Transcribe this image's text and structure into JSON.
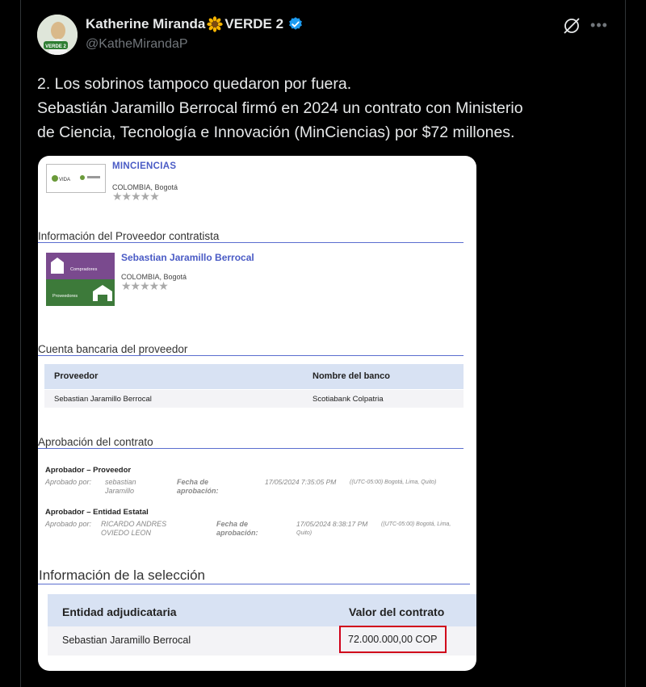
{
  "post": {
    "display_name": "Katherine Miranda",
    "name_suffix": "VERDE 2",
    "handle": "@KatheMirandaP",
    "avatar_text": "VERDE 2",
    "lines": [
      "2. Los sobrinos tampoco quedaron por fuera.",
      "Sebastián Jaramillo Berrocal firmó en 2024 un contrato con Ministerio",
      "de Ciencia, Tecnología e Innovación (MinCiencias) por $72 millones."
    ]
  },
  "doc": {
    "entity": {
      "name": "MINCIENCIAS",
      "location": "COLOMBIA, Bogotá",
      "logo_text": "VIDA",
      "stars": "★★★★★"
    },
    "provider_section": "Información del Proveedor contratista",
    "provider": {
      "name": "Sebastian Jaramillo Berrocal",
      "location": "COLOMBIA, Bogotá",
      "badge_top": "Compradores",
      "badge_bottom": "Proveedores",
      "stars": "★★★★★"
    },
    "bank_section": "Cuenta bancaria del proveedor",
    "bank_table": {
      "headers": [
        "Proveedor",
        "Nombre del banco"
      ],
      "row": [
        "Sebastian Jaramillo Berrocal",
        "Scotiabank Colpatria"
      ]
    },
    "approval_section": "Aprobación del contrato",
    "approvals": [
      {
        "title": "Aprobador – Proveedor",
        "approved_label": "Aprobado por:",
        "approved_by": "sebastian Jaramillo",
        "date_label": "Fecha de aprobación:",
        "date": "17/05/2024 7:35:05 PM",
        "tz": "((UTC-05:00) Bogotá, Lima, Quito)"
      },
      {
        "title": "Aprobador – Entidad Estatal",
        "approved_label": "Aprobado por:",
        "approved_by": "RICARDO ANDRES OVIEDO LEON",
        "date_label": "Fecha de aprobación:",
        "date": "17/05/2024 8:38:17 PM",
        "tz": "((UTC-05:00) Bogotá, Lima, Quito)"
      }
    ],
    "selection_section": "Información de la selección",
    "selection_table": {
      "headers": [
        "Entidad adjudicataria",
        "Valor del contrato"
      ],
      "row": [
        "Sebastian Jaramillo Berrocal",
        "72.000.000,00 COP"
      ]
    }
  },
  "colors": {
    "background": "#000000",
    "text": "#e7e9ea",
    "muted": "#71767b",
    "verified": "#1d9bf0",
    "doc_blue": "#4a5bc5",
    "highlight_box": "#d0021b"
  },
  "icons": [
    "sunflower-icon",
    "verified-badge-icon",
    "grok-icon",
    "more-icon",
    "star-icon"
  ]
}
